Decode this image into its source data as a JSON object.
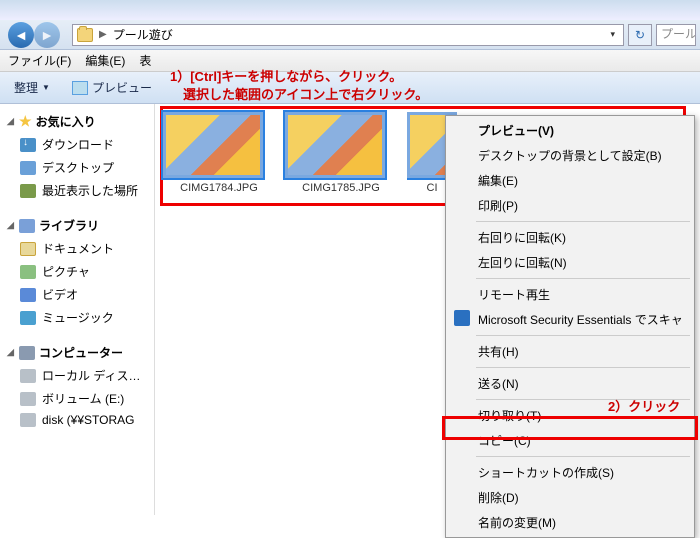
{
  "breadcrumb": {
    "folder": "プール遊び",
    "search_placeholder": "プール"
  },
  "menubar": {
    "file": "ファイル(F)",
    "edit": "編集(E)",
    "view_partial": "表"
  },
  "annotation": {
    "line1": "1）[Ctrl]キーを押しながら、クリック。",
    "line2": "　選択した範囲のアイコン上で右クリック。",
    "click2": "2）クリック"
  },
  "toolbar": {
    "organize": "整理",
    "preview": "プレビュー"
  },
  "sidebar": {
    "favorites": "お気に入り",
    "download": "ダウンロード",
    "desktop": "デスクトップ",
    "recent": "最近表示した場所",
    "library": "ライブラリ",
    "documents": "ドキュメント",
    "pictures": "ピクチャ",
    "video": "ビデオ",
    "music": "ミュージック",
    "computer": "コンピューター",
    "localdisk": "ローカル ディス…",
    "volume": "ボリューム (E:)",
    "netdisk": "disk (¥¥STORAG"
  },
  "thumbs": [
    {
      "label": "CIMG1784.JPG"
    },
    {
      "label": "CIMG1785.JPG"
    },
    {
      "label": "CI"
    }
  ],
  "contextmenu": {
    "preview": "プレビュー(V)",
    "set_bg": "デスクトップの背景として設定(B)",
    "edit": "編集(E)",
    "print": "印刷(P)",
    "rot_cw": "右回りに回転(K)",
    "rot_ccw": "左回りに回転(N)",
    "remote": "リモート再生",
    "mse": "Microsoft Security Essentials でスキャ",
    "share": "共有(H)",
    "send": "送る(N)",
    "cut": "切り取り(T)",
    "copy": "コピー(C)",
    "shortcut": "ショートカットの作成(S)",
    "delete": "削除(D)",
    "rename": "名前の変更(M)"
  }
}
